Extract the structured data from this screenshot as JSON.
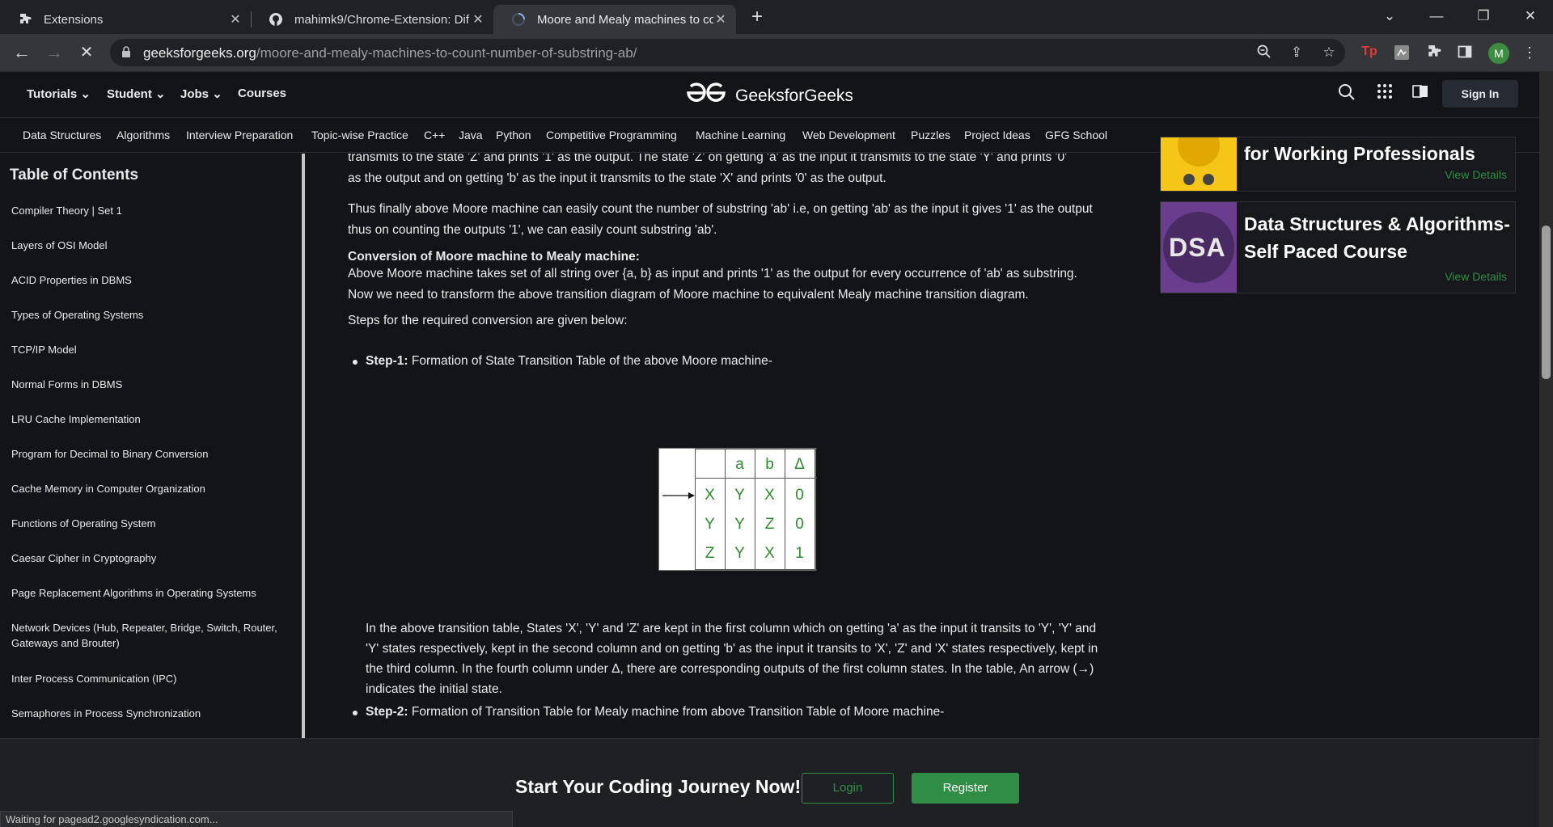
{
  "browser": {
    "tabs": [
      {
        "title": "Extensions",
        "icon": "puzzle-icon"
      },
      {
        "title": "mahimk9/Chrome-Extension: Dif",
        "icon": "github-icon"
      },
      {
        "title": "Moore and Mealy machines to co",
        "icon": "loading-icon",
        "active": true
      }
    ],
    "url_domain": "geeksforgeeks.org",
    "url_path": "/moore-and-mealy-machines-to-count-number-of-substring-ab/",
    "avatar_letter": "M",
    "status_text": "Waiting for pagead2.googlesyndication.com..."
  },
  "header": {
    "menus": [
      "Tutorials",
      "Student",
      "Jobs",
      "Courses"
    ],
    "logo_text": "GeeksforGeeks",
    "signin_label": "Sign In",
    "subnav": [
      "Data Structures",
      "Algorithms",
      "Interview Preparation",
      "Topic-wise Practice",
      "C++",
      "Java",
      "Python",
      "Competitive Programming",
      "Machine Learning",
      "Web Development",
      "Puzzles",
      "Project Ideas",
      "GFG School"
    ]
  },
  "toc": {
    "title": "Table of Contents",
    "items": [
      "Compiler Theory | Set 1",
      "Layers of OSI Model",
      "ACID Properties in DBMS",
      "Types of Operating Systems",
      "TCP/IP Model",
      "Normal Forms in DBMS",
      "LRU Cache Implementation",
      "Program for Decimal to Binary Conversion",
      "Cache Memory in Computer Organization",
      "Functions of Operating System",
      "Caesar Cipher in Cryptography",
      "Page Replacement Algorithms in Operating Systems",
      "Network Devices (Hub, Repeater, Bridge, Switch, Router, Gateways and Brouter)",
      "Inter Process Communication (IPC)",
      "Semaphores in Process Synchronization"
    ]
  },
  "article": {
    "p0_line1": "transmits to the state 'Z' and prints '1' as the output. The state 'Z' on getting 'a' as the input it transmits to the state 'Y' and prints '0'",
    "p0_line2": "as the output and on getting 'b' as the input it transmits to the state 'X' and prints '0' as the output.",
    "p1": "Thus finally above Moore machine can easily count the number of substring 'ab' i.e, on getting 'ab' as the input it gives '1' as the output thus on counting the outputs '1', we can easily count substring 'ab'.",
    "conv_heading": "Conversion of Moore machine to Mealy machine:",
    "p2": "Above Moore machine takes set of all string over {a, b} as input and prints '1' as the output for every occurrence of 'ab' as substring. Now we need to transform the above transition diagram of Moore machine to equivalent Mealy machine transition diagram.",
    "p3": "Steps for the required conversion are given below:",
    "step1_label": "Step-1:",
    "step1_text": " Formation of State Transition Table of the above Moore machine-",
    "p4": "In the above transition table, States 'X', 'Y' and 'Z' are kept in the first column which on getting 'a' as the input it transits to 'Y', 'Y' and 'Y' states respectively, kept in the second column and on getting 'b' as the input it transits to 'X', 'Z' and 'X' states respectively, kept in the third column. In the fourth column under Δ, there are corresponding outputs of the first column states. In the table, An arrow (→) indicates the initial state.",
    "step2_label": "Step-2:",
    "step2_text": " Formation of Transition Table for Mealy machine from above Transition Table of Moore machine-",
    "table": {
      "headers": [
        "a",
        "b",
        "Δ"
      ],
      "rows": [
        [
          "X",
          "Y",
          "X",
          "0"
        ],
        [
          "Y",
          "Y",
          "Z",
          "0"
        ],
        [
          "Z",
          "Y",
          "X",
          "1"
        ]
      ]
    }
  },
  "courses": [
    {
      "title": "for Working Professionals",
      "link": "View Details"
    },
    {
      "title_line1": "Data Structures & Algorithms-",
      "title_line2": "Self Paced Course",
      "thumb_text": "DSA",
      "link": "View Details"
    }
  ],
  "bottom": {
    "cta": "Start Your Coding Journey Now!",
    "login": "Login",
    "register": "Register"
  }
}
